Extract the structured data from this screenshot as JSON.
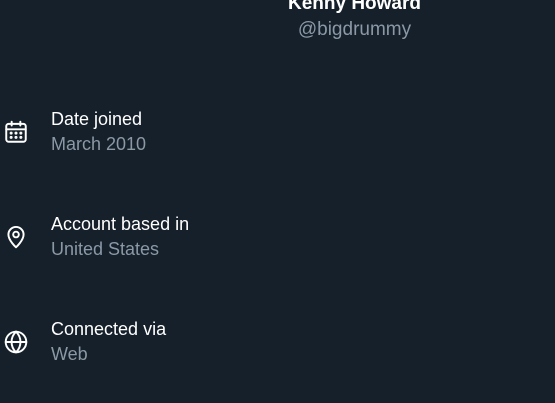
{
  "profile": {
    "name": "Kenny Howard",
    "handle": "@bigdrummy"
  },
  "about": {
    "items": [
      {
        "icon": "calendar-icon",
        "label": "Date joined",
        "value": "March 2010"
      },
      {
        "icon": "location-pin-icon",
        "label": "Account based in",
        "value": "United States"
      },
      {
        "icon": "globe-icon",
        "label": "Connected via",
        "value": "Web"
      }
    ]
  },
  "colors": {
    "background": "#15202b",
    "primary_text": "#ffffff",
    "secondary_text": "#8b98a5"
  }
}
